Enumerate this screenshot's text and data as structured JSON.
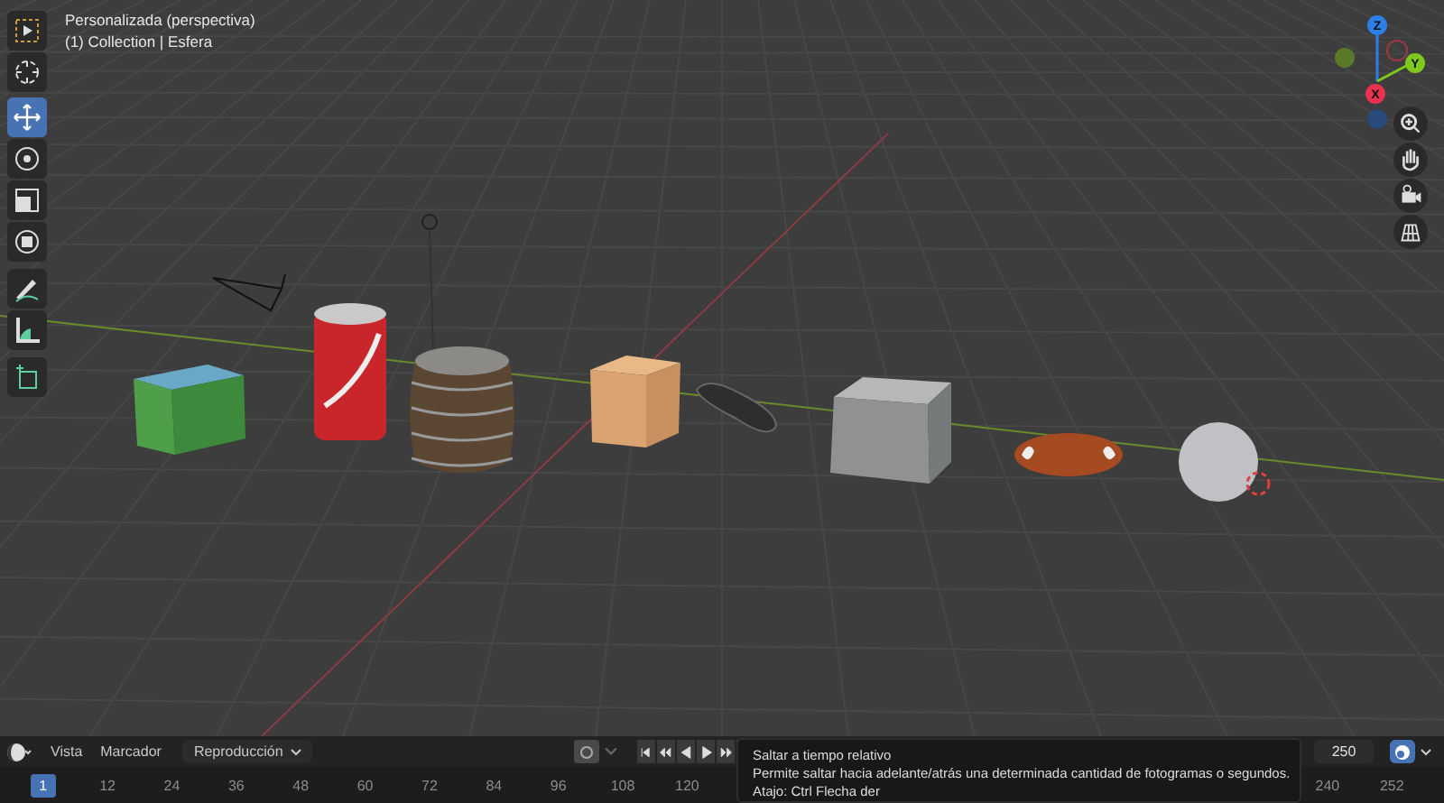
{
  "viewport": {
    "view_name": "Personalizada (perspectiva)",
    "collection": "(1) Collection | Esfera"
  },
  "toolbar": [
    {
      "kind": "select",
      "selected": false
    },
    {
      "kind": "cursor",
      "selected": false
    },
    {
      "kind": "move",
      "selected": true
    },
    {
      "kind": "rotate",
      "selected": false
    },
    {
      "kind": "scale",
      "selected": false
    },
    {
      "kind": "transform",
      "selected": false
    },
    {
      "kind": "annotate",
      "selected": false
    },
    {
      "kind": "measure",
      "selected": false
    },
    {
      "kind": "add-cube",
      "selected": false
    }
  ],
  "gizmo": {
    "axes": [
      {
        "label": "Z",
        "color": "#2e7ee8"
      },
      {
        "label": "Y",
        "color": "#7ec91c"
      },
      {
        "label": "X",
        "color": "#e8324f"
      }
    ]
  },
  "view_buttons": [
    {
      "kind": "zoom"
    },
    {
      "kind": "pan"
    },
    {
      "kind": "camera"
    },
    {
      "kind": "grid"
    }
  ],
  "timeline": {
    "menus": [
      "Vista",
      "Marcador"
    ],
    "playback_menu": "Reproducción",
    "frame_end": "250",
    "frame_ticks": [
      {
        "label": "1",
        "selected": true
      },
      {
        "label": "12",
        "selected": false
      },
      {
        "label": "24",
        "selected": false
      },
      {
        "label": "36",
        "selected": false
      },
      {
        "label": "48",
        "selected": false
      },
      {
        "label": "60",
        "selected": false
      },
      {
        "label": "72",
        "selected": false
      },
      {
        "label": "84",
        "selected": false
      },
      {
        "label": "96",
        "selected": false
      },
      {
        "label": "108",
        "selected": false
      },
      {
        "label": "120",
        "selected": false
      }
    ],
    "frame_ticks_end": [
      {
        "label": "240",
        "selected": false
      },
      {
        "label": "252",
        "selected": false
      }
    ]
  },
  "tooltip": {
    "title": "Saltar a tiempo relativo",
    "description": "Permite saltar hacia adelante/atrás una determinada cantidad de fotogramas o segundos.",
    "shortcut": "Atajo: Ctrl Flecha der"
  }
}
